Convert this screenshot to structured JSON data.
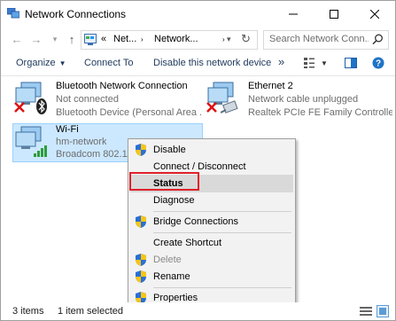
{
  "window": {
    "title": "Network Connections"
  },
  "address": {
    "breadcrumb_overflow": "«",
    "crumbs": [
      "Net...",
      "Network..."
    ],
    "search_placeholder": "Search Network Conn..."
  },
  "commands": {
    "organize": "Organize",
    "connect_to": "Connect To",
    "disable": "Disable this network device",
    "more": "»"
  },
  "items": [
    {
      "name": "Bluetooth Network Connection",
      "status": "Not connected",
      "device": "Bluetooth Device (Personal Area ..."
    },
    {
      "name": "Ethernet 2",
      "status": "Network cable unplugged",
      "device": "Realtek PCIe FE Family Controller ..."
    },
    {
      "name": "Wi-Fi",
      "status": "hm-network",
      "device": "Broadcom 802.11a"
    }
  ],
  "context_menu": {
    "items": [
      {
        "label": "Disable",
        "shield": true,
        "disabled": false
      },
      {
        "label": "Connect / Disconnect",
        "shield": false,
        "disabled": false
      },
      {
        "label": "Status",
        "shield": false,
        "disabled": false,
        "bold": true,
        "highlighted": true
      },
      {
        "label": "Diagnose",
        "shield": false,
        "disabled": false
      },
      {
        "label": "Bridge Connections",
        "shield": true,
        "disabled": false
      },
      {
        "label": "Create Shortcut",
        "shield": false,
        "disabled": false
      },
      {
        "label": "Delete",
        "shield": true,
        "disabled": true
      },
      {
        "label": "Rename",
        "shield": true,
        "disabled": false
      },
      {
        "label": "Properties",
        "shield": true,
        "disabled": false
      }
    ]
  },
  "statusbar": {
    "count": "3 items",
    "selected": "1 item selected"
  },
  "colors": {
    "selection": "#cce8ff",
    "accent_red": "#e0202a",
    "command_text": "#1e395b"
  }
}
